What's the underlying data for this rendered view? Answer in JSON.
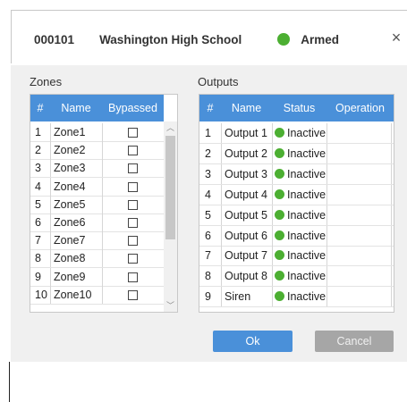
{
  "header": {
    "id": "000101",
    "name": "Washington High School",
    "status": "Armed",
    "status_color": "#4caf32",
    "close": "×"
  },
  "zones": {
    "label": "Zones",
    "columns": [
      "#",
      "Name",
      "Bypassed"
    ],
    "rows": [
      {
        "num": "1",
        "name": "Zone1"
      },
      {
        "num": "2",
        "name": "Zone2"
      },
      {
        "num": "3",
        "name": "Zone3"
      },
      {
        "num": "4",
        "name": "Zone4"
      },
      {
        "num": "5",
        "name": "Zone5"
      },
      {
        "num": "6",
        "name": "Zone6"
      },
      {
        "num": "7",
        "name": "Zone7"
      },
      {
        "num": "8",
        "name": "Zone8"
      },
      {
        "num": "9",
        "name": "Zone9"
      },
      {
        "num": "10",
        "name": "Zone10"
      }
    ]
  },
  "outputs": {
    "label": "Outputs",
    "columns": [
      "#",
      "Name",
      "Status",
      "Operation"
    ],
    "rows": [
      {
        "num": "1",
        "name": "Output 1",
        "status": "Inactive"
      },
      {
        "num": "2",
        "name": "Output 2",
        "status": "Inactive"
      },
      {
        "num": "3",
        "name": "Output 3",
        "status": "Inactive"
      },
      {
        "num": "4",
        "name": "Output 4",
        "status": "Inactive"
      },
      {
        "num": "5",
        "name": "Output 5",
        "status": "Inactive"
      },
      {
        "num": "6",
        "name": "Output 6",
        "status": "Inactive"
      },
      {
        "num": "7",
        "name": "Output 7",
        "status": "Inactive"
      },
      {
        "num": "8",
        "name": "Output 8",
        "status": "Inactive"
      },
      {
        "num": "9",
        "name": "Siren",
        "status": "Inactive"
      }
    ]
  },
  "buttons": {
    "ok": "Ok",
    "cancel": "Cancel"
  },
  "colors": {
    "accent": "#4a90d9",
    "active_dot": "#4caf32",
    "cancel_bg": "#a6a6a6"
  }
}
